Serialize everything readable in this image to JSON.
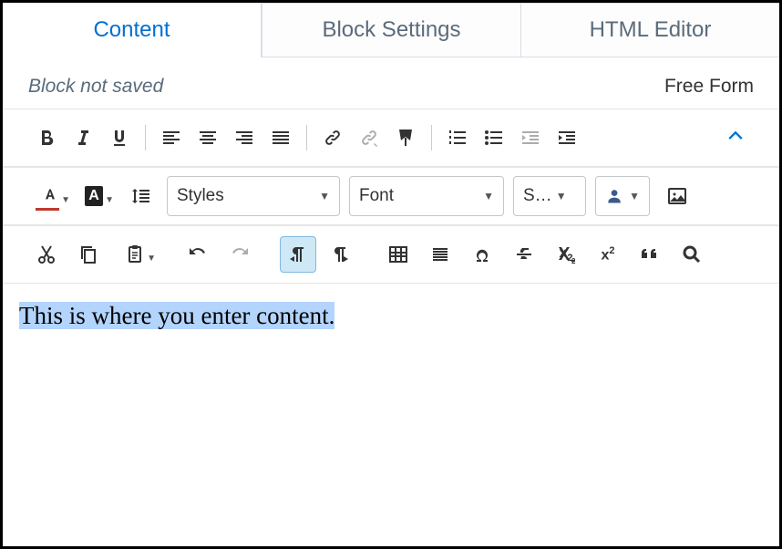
{
  "tabs": {
    "content": "Content",
    "block_settings": "Block Settings",
    "html_editor": "HTML Editor"
  },
  "status": {
    "not_saved": "Block not saved",
    "mode": "Free Form"
  },
  "dropdowns": {
    "styles": "Styles",
    "font": "Font",
    "size": "S…"
  },
  "editor": {
    "content": "This is where you enter content."
  }
}
